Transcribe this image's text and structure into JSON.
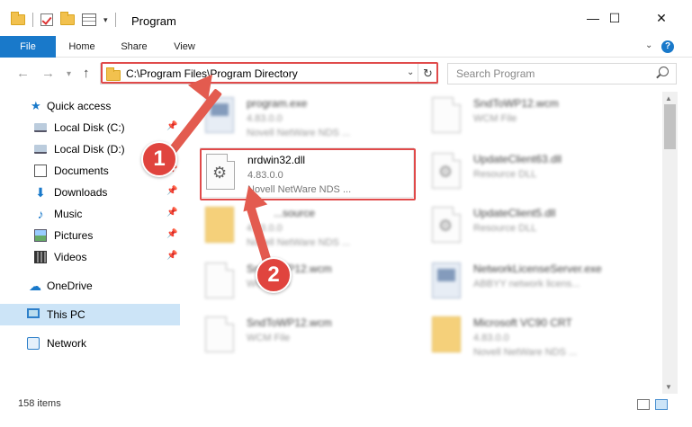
{
  "window": {
    "title": "Program",
    "controls": {
      "minimize": "—",
      "maximize": "☐",
      "close": "✕"
    }
  },
  "ribbon": {
    "tabs": [
      "File",
      "Home",
      "Share",
      "View"
    ],
    "help": "?"
  },
  "address": {
    "path": "C:\\Program Files\\Program Directory",
    "search_placeholder": "Search Program"
  },
  "sidebar": {
    "quick_access": "Quick access",
    "items": [
      {
        "label": "Local Disk (C:)",
        "icon": "disk-icon",
        "pinned": true
      },
      {
        "label": "Local Disk (D:)",
        "icon": "disk-icon",
        "pinned": true
      },
      {
        "label": "Documents",
        "icon": "documents-icon",
        "pinned": true
      },
      {
        "label": "Downloads",
        "icon": "downloads-icon",
        "pinned": true
      },
      {
        "label": "Music",
        "icon": "music-icon",
        "pinned": true
      },
      {
        "label": "Pictures",
        "icon": "pictures-icon",
        "pinned": true
      },
      {
        "label": "Videos",
        "icon": "videos-icon",
        "pinned": true
      }
    ],
    "onedrive": "OneDrive",
    "this_pc": "This PC",
    "network": "Network"
  },
  "files": [
    {
      "name": "program.exe",
      "line2": "4.83.0.0",
      "line3": "Novell NetWare NDS ...",
      "kind": "exe"
    },
    {
      "name": "SndToWP12.wcm",
      "line2": "WCM File",
      "line3": "",
      "kind": "file"
    },
    {
      "name": "nrdwin32.dll",
      "line2": "4.83.0.0",
      "line3": "Novell NetWare NDS ...",
      "kind": "dll"
    },
    {
      "name": "UpdateClient63.dll",
      "line2": "Resource DLL",
      "line3": "",
      "kind": "dll"
    },
    {
      "name": "...source",
      "line2": "4.83.0.0",
      "line3": "Novell NetWare NDS ...",
      "kind": "folder"
    },
    {
      "name": "UpdateClient5.dll",
      "line2": "Resource DLL",
      "line3": "",
      "kind": "dll"
    },
    {
      "name": "SndToWP12.wcm",
      "line2": "WCM File",
      "line3": "",
      "kind": "file"
    },
    {
      "name": "NetworkLicenseServer.exe",
      "line2": "ABBYY network licens...",
      "line3": "",
      "kind": "exe"
    },
    {
      "name": "SndToWP12.wcm",
      "line2": "WCM File",
      "line3": "",
      "kind": "file"
    },
    {
      "name": "Microsoft VC90 CRT",
      "line2": "4.83.0.0",
      "line3": "Novell NetWare NDS ...",
      "kind": "folder"
    }
  ],
  "status": {
    "count": "158 items"
  },
  "annotations": {
    "step1": "1",
    "step2": "2"
  },
  "colors": {
    "accent": "#1979ca",
    "annotation": "#e0443e"
  }
}
